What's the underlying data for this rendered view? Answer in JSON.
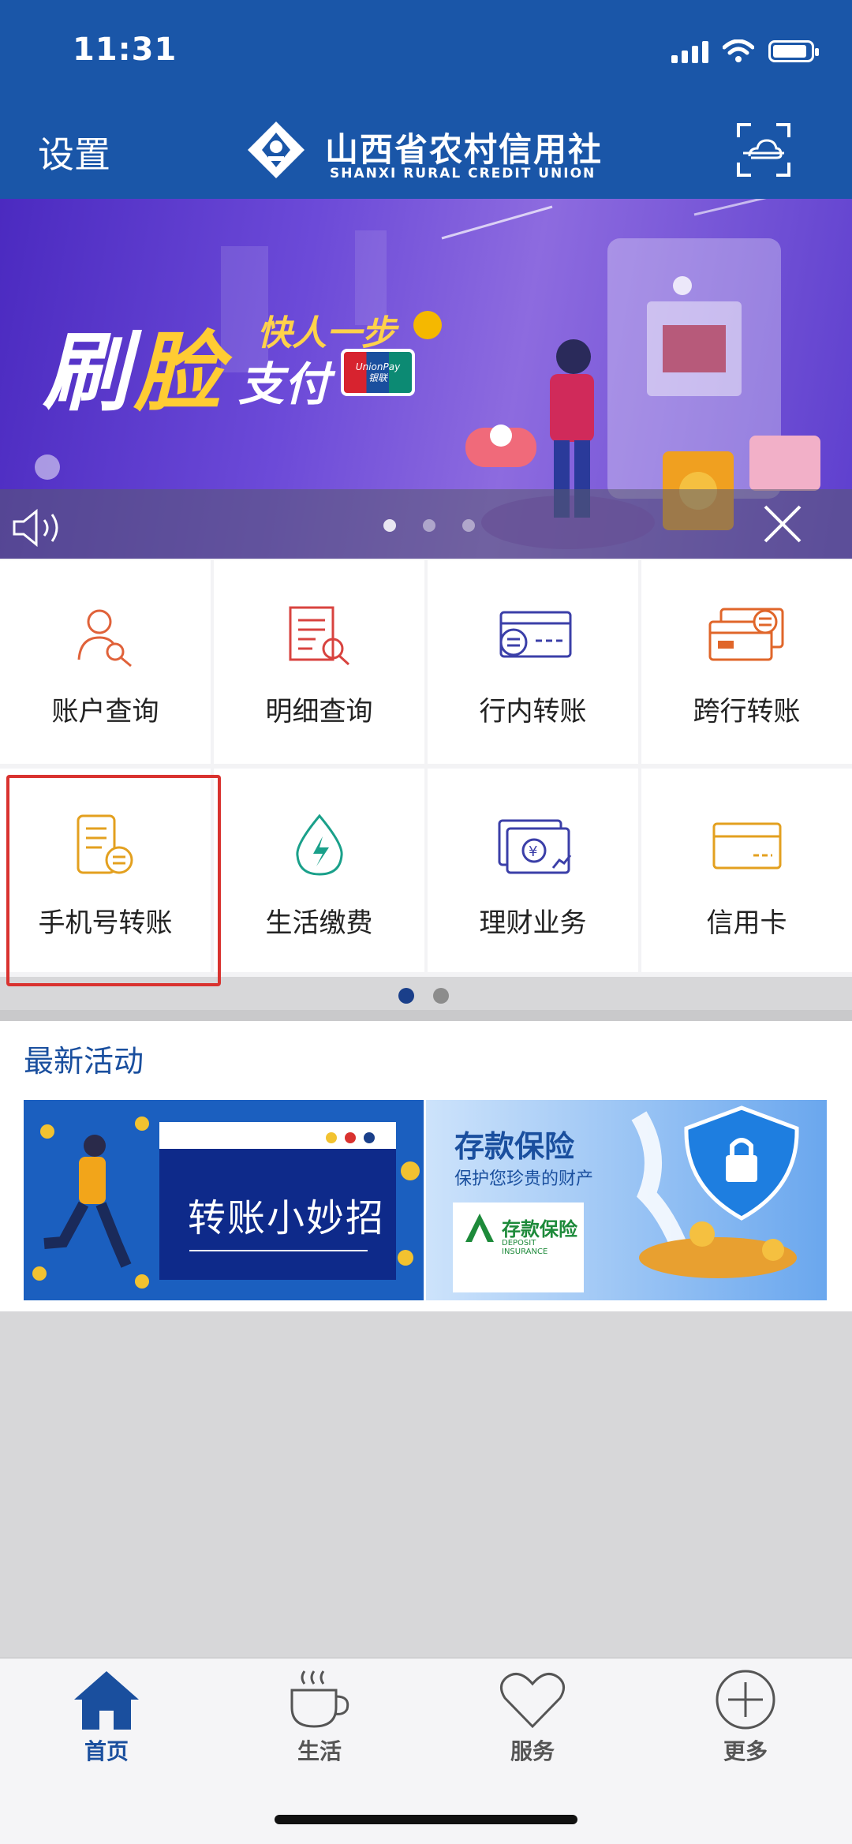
{
  "status": {
    "time": "11:31"
  },
  "header": {
    "settings_label": "设置",
    "logo_cn": "山西省农村信用社",
    "logo_en": "SHANXI RURAL CREDIT UNION",
    "brand_color": "#1a56a8"
  },
  "banner": {
    "title_part1": "刷",
    "title_part2": "脸",
    "subtitle1": "快人一步",
    "subtitle2": "支付",
    "unionpay_en": "UnionPay",
    "unionpay_cn": "银联",
    "pages": 3,
    "active_page": 1
  },
  "grid": {
    "items": [
      {
        "label": "账户查询",
        "icon": "account-query-icon"
      },
      {
        "label": "明细查询",
        "icon": "detail-query-icon"
      },
      {
        "label": "行内转账",
        "icon": "intra-bank-transfer-icon"
      },
      {
        "label": "跨行转账",
        "icon": "inter-bank-transfer-icon"
      },
      {
        "label": "手机号转账",
        "icon": "phone-transfer-icon"
      },
      {
        "label": "生活缴费",
        "icon": "utility-payment-icon"
      },
      {
        "label": "理财业务",
        "icon": "wealth-management-icon"
      },
      {
        "label": "信用卡",
        "icon": "credit-card-icon"
      }
    ],
    "pages": 2,
    "active_page": 1,
    "highlight_color": "#d9322f"
  },
  "activities": {
    "title": "最新活动",
    "card1_text": "转账小妙招",
    "card2_title": "存款保险",
    "card2_subtitle": "保护您珍贵的财产",
    "card2_badge": "存款保险",
    "card2_badge_en": "DEPOSIT INSURANCE"
  },
  "tabbar": {
    "tabs": [
      {
        "label": "首页",
        "icon": "home-icon",
        "active": true
      },
      {
        "label": "生活",
        "icon": "coffee-cup-icon",
        "active": false
      },
      {
        "label": "服务",
        "icon": "heart-icon",
        "active": false
      },
      {
        "label": "更多",
        "icon": "plus-circle-icon",
        "active": false
      }
    ],
    "active_color": "#1a4f9e"
  }
}
